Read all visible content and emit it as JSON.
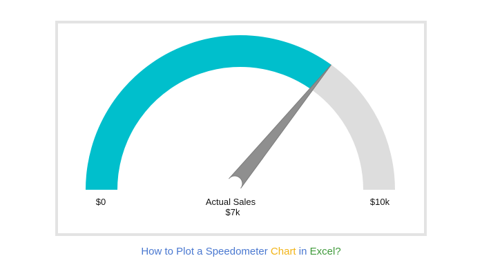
{
  "chart_data": {
    "type": "gauge",
    "min": 0,
    "max": 10,
    "value": 7,
    "min_label": "$0",
    "max_label": "$10k",
    "value_title": "Actual Sales",
    "value_label": "$7k",
    "colors": {
      "filled": "#00bfcc",
      "remaining": "#dddddd",
      "needle": "#8f8f8f",
      "needle_edge": "#7c7c7c"
    }
  },
  "caption": {
    "part1": "How to Plot a Speedometer",
    "part2": "Chart",
    "part3": "in",
    "part4": "Excel?",
    "colors": {
      "part1": "#4a78d0",
      "part2": "#f2b418",
      "part3": "#4a78d0",
      "part4": "#3f9a3a"
    }
  }
}
